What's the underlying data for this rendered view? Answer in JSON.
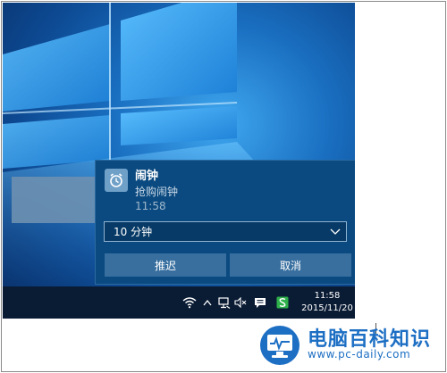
{
  "notification": {
    "app_name": "闹钟",
    "message": "抢购闹钟",
    "time": "11:58",
    "snooze_option": "10 分钟",
    "snooze_label": "推迟",
    "dismiss_label": "取消"
  },
  "taskbar": {
    "clock_time": "11:58",
    "clock_date": "2015/11/20",
    "tray_icons": [
      "wifi-icon",
      "chevron-up-icon",
      "network-icon",
      "volume-mute-icon",
      "action-center-icon",
      "app-s-icon"
    ]
  },
  "watermark": {
    "title": "电脑百科知识",
    "url": "www.pc-daily.com"
  },
  "colors": {
    "toast_bg": "#0b4a80",
    "button_bg": "#386f9f",
    "taskbar_bg": "#0a1b34",
    "accent_green": "#2eb14a",
    "watermark_blue": "#1d6fc4"
  }
}
